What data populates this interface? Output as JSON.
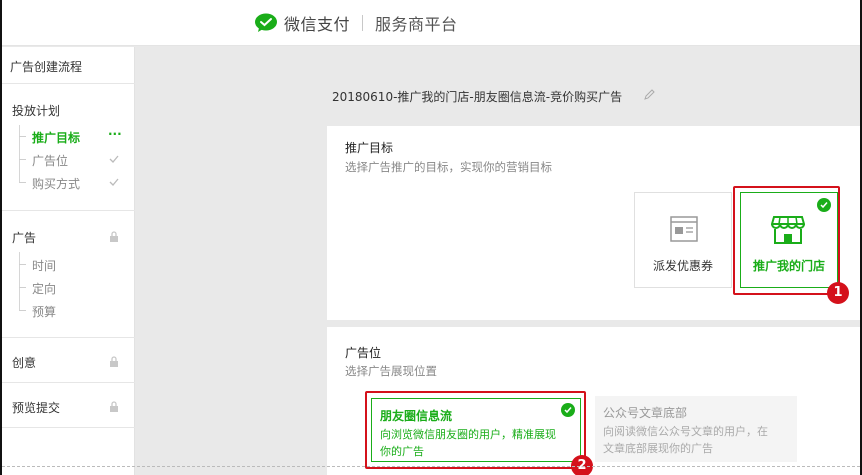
{
  "header": {
    "brand": "微信支付",
    "platform": "服务商平台"
  },
  "sidebar": {
    "title": "广告创建流程",
    "groups": [
      {
        "label": "投放计划",
        "items": [
          {
            "label": "推广目标",
            "status": "in-progress"
          },
          {
            "label": "广告位",
            "status": "done"
          },
          {
            "label": "购买方式",
            "status": "done"
          }
        ]
      },
      {
        "label": "广告",
        "locked": true,
        "items": [
          {
            "label": "时间"
          },
          {
            "label": "定向"
          },
          {
            "label": "预算"
          }
        ]
      },
      {
        "label": "创意",
        "locked": true
      },
      {
        "label": "预览提交",
        "locked": true
      }
    ],
    "progress_dots": "···"
  },
  "main": {
    "ad_name": "20180610-推广我的门店-朋友圈信息流-竞价购买广告",
    "target": {
      "title": "推广目标",
      "subtitle": "选择广告推广的目标，实现你的营销目标",
      "options": [
        {
          "label": "派发优惠券",
          "icon": "coupon-icon",
          "selected": false
        },
        {
          "label": "推广我的门店",
          "icon": "store-icon",
          "selected": true
        }
      ],
      "callout": "1"
    },
    "placement": {
      "title": "广告位",
      "subtitle": "选择广告展现位置",
      "options": [
        {
          "title": "朋友圈信息流",
          "desc": "向浏览微信朋友圈的用户，精准展现你的广告",
          "selected": true
        },
        {
          "title": "公众号文章底部",
          "desc": "向阅读微信公众号文章的用户，在文章底部展现你的广告",
          "selected": false
        }
      ],
      "callout": "2"
    }
  },
  "colors": {
    "accent": "#1aad19",
    "highlight": "#d4111b"
  }
}
